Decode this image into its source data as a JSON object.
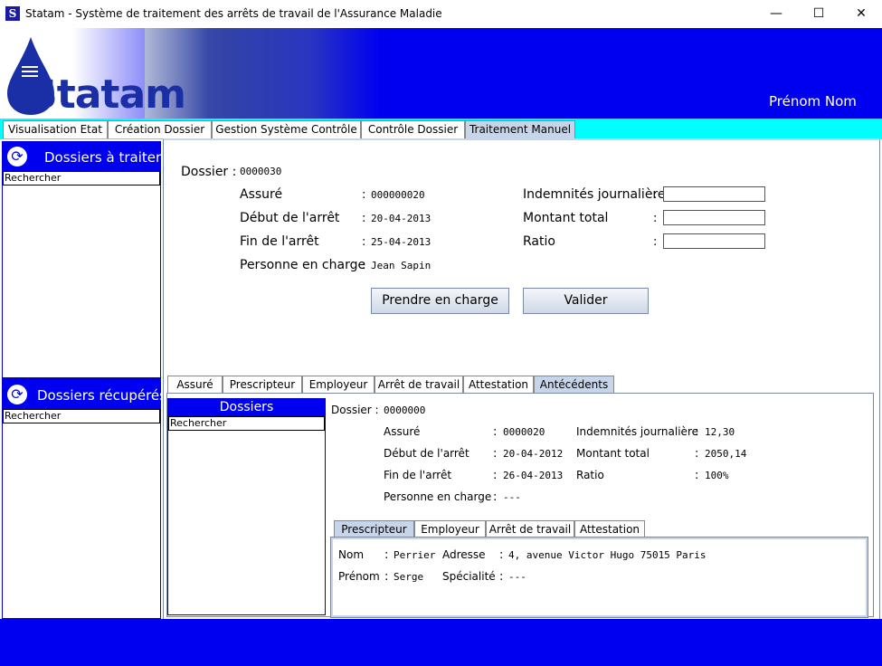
{
  "window": {
    "title": "Statam - Système de traitement des arrêts de travail de l'Assurance Maladie",
    "app_icon_letter": "S",
    "minimize": "—",
    "maximize": "☐",
    "close": "✕"
  },
  "header": {
    "logo_text": "Statam",
    "user_name": "Prénom Nom",
    "bg_color": "#0000f0"
  },
  "main_tabs": [
    "Visualisation Etat",
    "Création Dossier",
    "Gestion Système Contrôle",
    "Contrôle Dossier",
    "Traitement Manuel"
  ],
  "sidebar": {
    "to_process": {
      "title": "Dossiers à traiter",
      "search": "Rechercher"
    },
    "retrieved": {
      "title": "Dossiers récupérés",
      "search": "Rechercher"
    }
  },
  "dossier": {
    "label": "Dossier :",
    "number": "0000030",
    "fields_left": [
      {
        "label": "Assuré",
        "value": "000000020"
      },
      {
        "label": "Début de l'arrêt",
        "value": "20-04-2013"
      },
      {
        "label": "Fin de l'arrêt",
        "value": "25-04-2013"
      },
      {
        "label": "Personne en charge",
        "value": "Jean Sapin"
      }
    ],
    "fields_right": [
      {
        "label": "Indemnités journalière",
        "value": ""
      },
      {
        "label": "Montant total",
        "value": ""
      },
      {
        "label": "Ratio",
        "value": ""
      }
    ],
    "take_charge_button": "Prendre en charge",
    "validate_button": "Valider"
  },
  "sub_tabs": [
    "Assuré",
    "Prescripteur",
    "Employeur",
    "Arrêt de travail",
    "Attestation",
    "Antécédents"
  ],
  "antecedents": {
    "list_title": "Dossiers",
    "search": "Rechercher",
    "dossier_label": "Dossier :",
    "dossier_number": "0000000",
    "fields_left": [
      {
        "label": "Assuré",
        "value": "0000020"
      },
      {
        "label": "Début de l'arrêt",
        "value": "20-04-2012"
      },
      {
        "label": "Fin de l'arrêt",
        "value": "26-04-2013"
      },
      {
        "label": "Personne en charge",
        "value": "---"
      }
    ],
    "fields_right": [
      {
        "label": "Indemnités journalière",
        "value": "12,30"
      },
      {
        "label": "Montant total",
        "value": "2050,14"
      },
      {
        "label": "Ratio",
        "value": "100%"
      }
    ],
    "inner_tabs": [
      "Prescripteur",
      "Employeur",
      "Arrêt de travail",
      "Attestation"
    ],
    "prescripteur": {
      "nom_label": "Nom",
      "nom_value": "Perrier",
      "prenom_label": "Prénom",
      "prenom_value": "Serge",
      "adresse_label": "Adresse",
      "adresse_value": "4, avenue Victor Hugo 75015 Paris",
      "specialite_label": "Spécialité",
      "specialite_value": "---"
    }
  }
}
